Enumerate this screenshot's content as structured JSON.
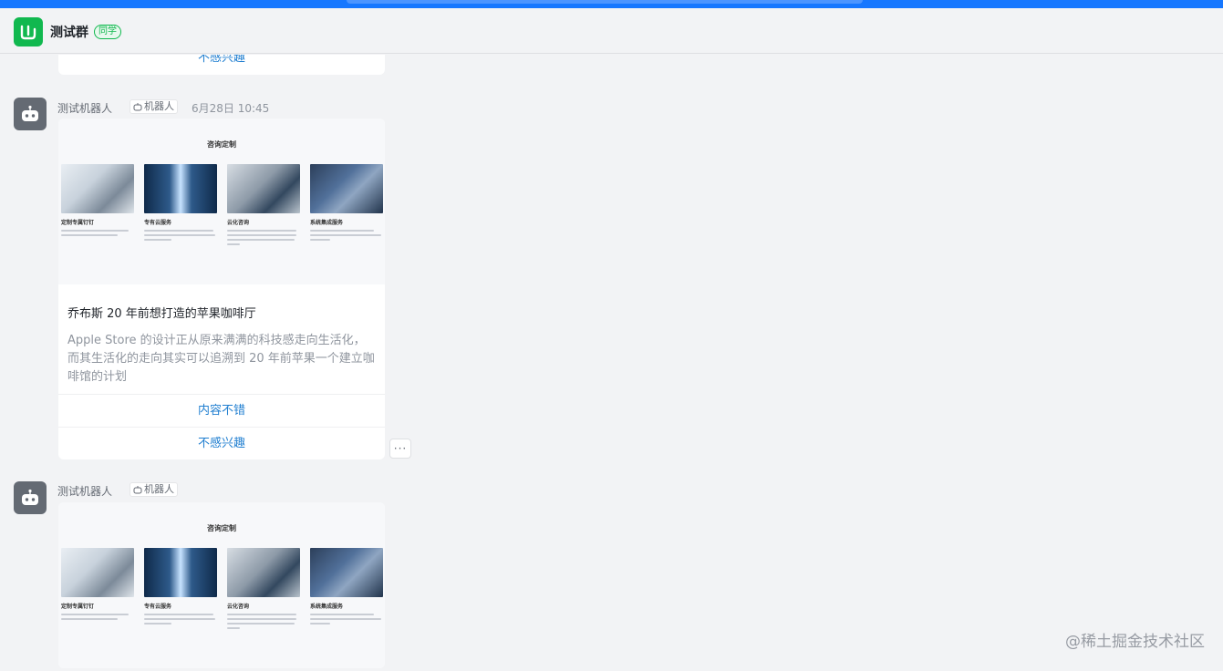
{
  "header": {
    "title": "测试群",
    "tag": "同学",
    "logo_icon": "group-logo-icon"
  },
  "top_card": {
    "action": "不感兴趣"
  },
  "messages": [
    {
      "sender": "测试机器人",
      "badge": "机器人",
      "time": "6月28日 10:45",
      "preview": {
        "title": "咨询定制",
        "tiles": [
          {
            "name": "定制专属钉钉"
          },
          {
            "name": "专有云服务"
          },
          {
            "name": "云化咨询"
          },
          {
            "name": "系统集成服务"
          }
        ]
      },
      "card_title": "乔布斯 20 年前想打造的苹果咖啡厅",
      "card_desc": "Apple Store 的设计正从原来满满的科技感走向生活化，而其生活化的走向其实可以追溯到 20 年前苹果一个建立咖啡馆的计划",
      "actions": [
        "内容不错",
        "不感兴趣"
      ],
      "more": "···"
    },
    {
      "sender": "测试机器人",
      "badge": "机器人",
      "preview": {
        "title": "咨询定制",
        "tiles": [
          {
            "name": "定制专属钉钉"
          },
          {
            "name": "专有云服务"
          },
          {
            "name": "云化咨询"
          },
          {
            "name": "系统集成服务"
          }
        ]
      }
    }
  ],
  "watermark": "@稀土掘金技术社区",
  "colors": {
    "brand": "#1677ff",
    "logo": "#11b84f",
    "link": "#1f7ed0"
  }
}
